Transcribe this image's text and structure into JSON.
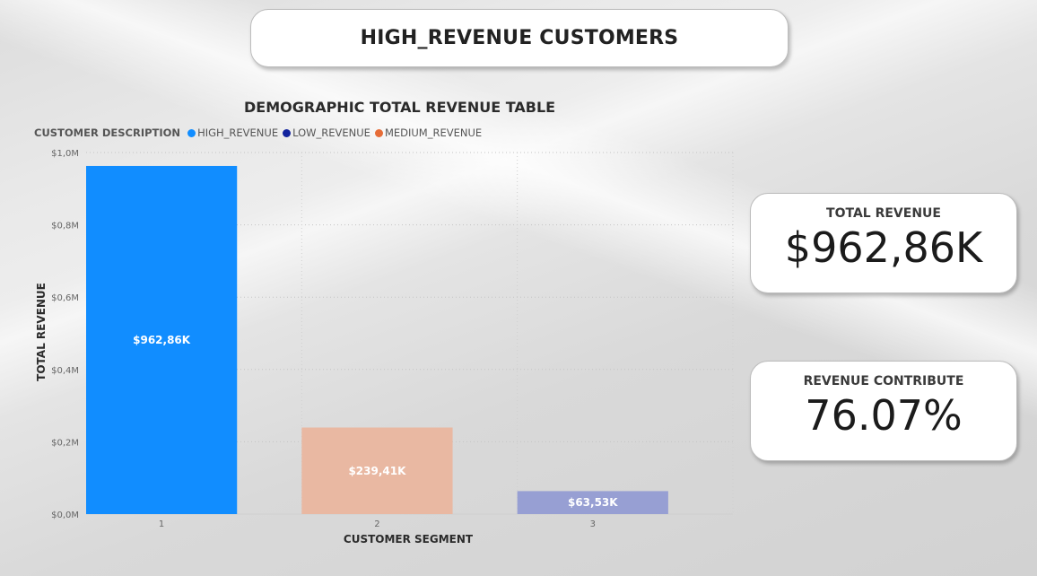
{
  "header": {
    "title": "HIGH_REVENUE CUSTOMERS"
  },
  "kpis": [
    {
      "label": "TOTAL REVENUE",
      "value": "$962,86K"
    },
    {
      "label": "REVENUE CONTRIBUTE",
      "value": "76.07%"
    }
  ],
  "chart_data": {
    "type": "bar",
    "title": "DEMOGRAPHIC TOTAL REVENUE TABLE",
    "legend_title": "CUSTOMER DESCRIPTION",
    "legend": [
      {
        "name": "HIGH_REVENUE",
        "color": "#118DFF"
      },
      {
        "name": "LOW_REVENUE",
        "color": "#12239E"
      },
      {
        "name": "MEDIUM_REVENUE",
        "color": "#E66C37"
      }
    ],
    "legend_placement": "top-left",
    "xlabel": "CUSTOMER SEGMENT",
    "ylabel": "TOTAL REVENUE",
    "categories": [
      "1",
      "2",
      "3"
    ],
    "values": [
      962.86,
      239.41,
      63.53
    ],
    "value_unit": "K",
    "data_labels": [
      "$962,86K",
      "$239,41K",
      "$63,53K"
    ],
    "bar_colors": [
      "#118DFF",
      "#E9B8A2",
      "#979FD3"
    ],
    "ylim": [
      0,
      1000
    ],
    "yticks": [
      {
        "value": 0,
        "label": "$0,0M"
      },
      {
        "value": 200,
        "label": "$0,2M"
      },
      {
        "value": 400,
        "label": "$0,4M"
      },
      {
        "value": 600,
        "label": "$0,6M"
      },
      {
        "value": 800,
        "label": "$0,8M"
      },
      {
        "value": 1000,
        "label": "$1,0M"
      }
    ],
    "grid": true
  }
}
